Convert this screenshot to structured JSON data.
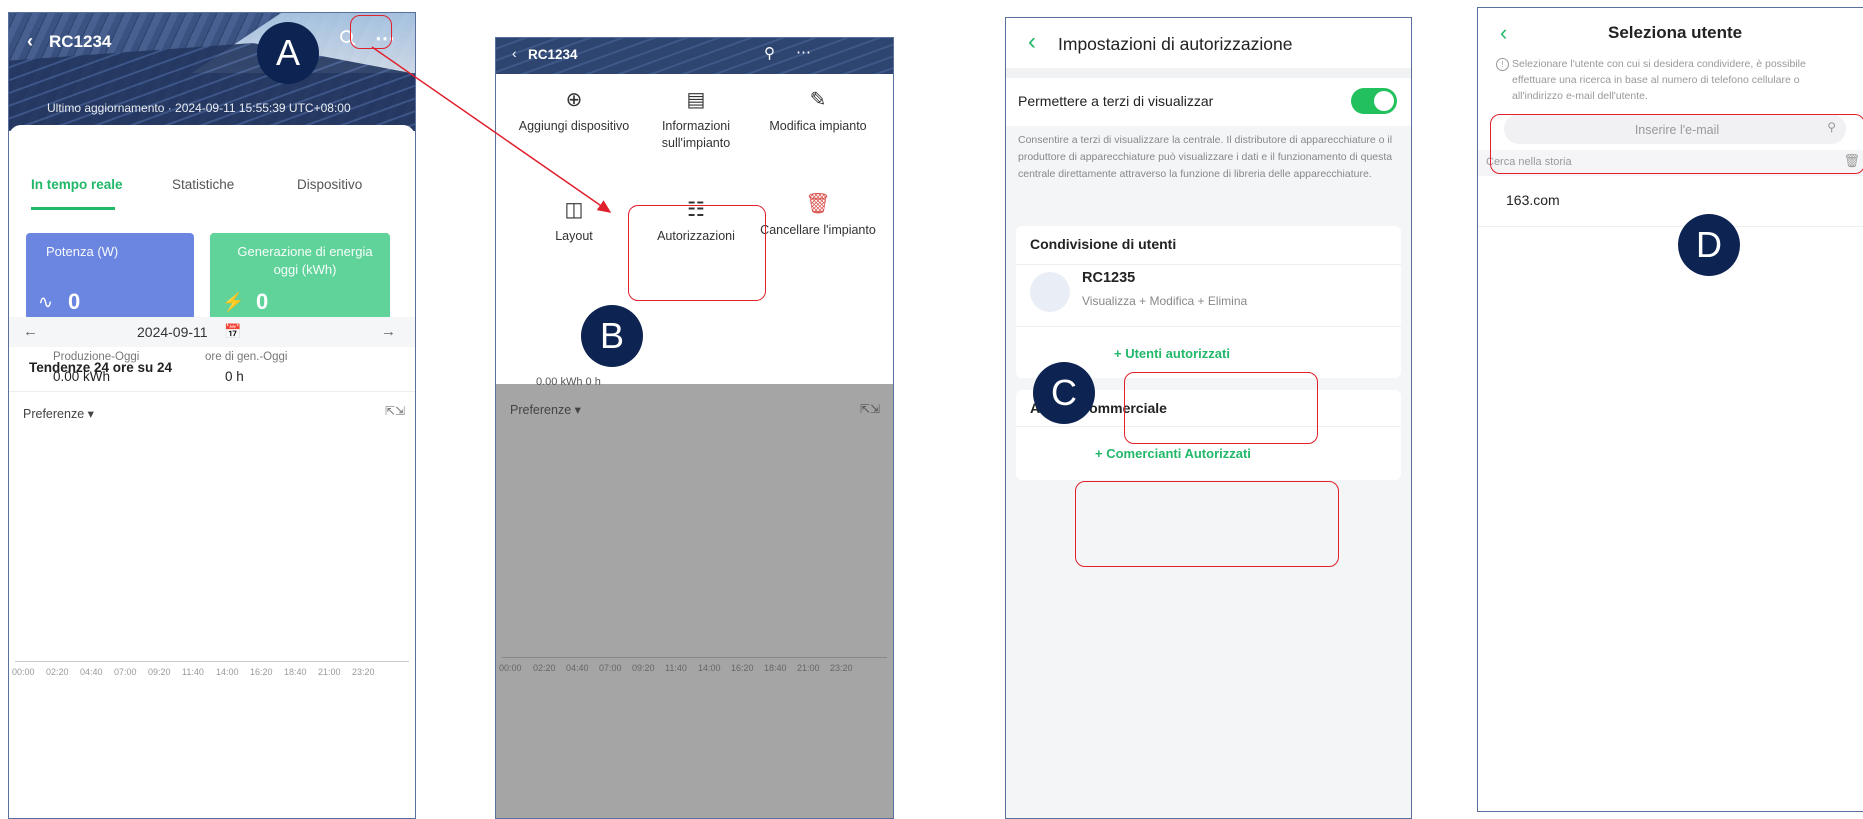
{
  "screen1": {
    "title": "RC1234",
    "last_update": "Ultimo aggiornamento · 2024-09-11 15:55:39 UTC+08:00",
    "tabs": [
      "In tempo reale",
      "Statistiche",
      "Dispositivo"
    ],
    "power_card": {
      "label": "Potenza (W)",
      "value": "0",
      "color": "#6b86e0"
    },
    "energy_card": {
      "label": "Generazione di energia oggi (kWh)",
      "value": "0",
      "color": "#5fd39a"
    },
    "trend_title": "Tendenze 24 ore su 24",
    "date": "2024-09-11",
    "kpi": {
      "production_label": "Produzione-Oggi",
      "production_value": "0.00 kWh",
      "hours_label": "ore di gen.-Oggi",
      "hours_value": "0 h"
    },
    "preference_label": "Preferenze",
    "axis_ticks": [
      "00:00",
      "02:20",
      "04:40",
      "07:00",
      "09:20",
      "11:40",
      "14:00",
      "16:20",
      "18:40",
      "21:00",
      "23:20"
    ]
  },
  "screen2": {
    "title": "RC1234",
    "menu": [
      {
        "icon": "plus-circle-icon",
        "label": "Aggiungi dispositivo"
      },
      {
        "icon": "list-icon",
        "label": "Informazioni sull'impianto"
      },
      {
        "icon": "pencil-icon",
        "label": "Modifica impianto"
      },
      {
        "icon": "layout-icon",
        "label": "Layout"
      },
      {
        "icon": "authorization-icon",
        "label": "Autorizzazioni"
      },
      {
        "icon": "trash-icon",
        "label": "Cancellare l'impianto"
      }
    ],
    "partial_values": "0.00 kWh   0 h",
    "preference_label": "Preferenze"
  },
  "screen3": {
    "title": "Impostazioni di autorizzazione",
    "toggle_label": "Permettere a terzi di visualizzar",
    "toggle_on": true,
    "description": "Consentire a terzi di visualizzare la centrale. Il distributore di apparecchiature o il produttore di apparecchiature può visualizzare i dati e il funzionamento di questa centrale direttamente attraverso la funzione di libreria delle apparecchiature.",
    "user_sharing": {
      "title": "Condivisione di utenti",
      "user_name": "RC1235",
      "permissions": "Visualizza + Modifica + Elimina",
      "add_button": "+ Utenti autorizzati"
    },
    "business": {
      "title": "Attività commerciale",
      "add_button": "+ Comercianti Autorizzati"
    }
  },
  "screen4": {
    "title": "Seleziona utente",
    "note": "Selezionare l'utente con cui si desidera condividere, è possibile effettuare una ricerca in base al numero di telefono cellulare o all'indirizzo e-mail dell'utente.",
    "search_placeholder": "Inserire l'e-mail",
    "history_label": "Cerca nella storia",
    "history_items": [
      "163.com"
    ]
  },
  "annotations": {
    "badges": [
      "A",
      "B",
      "C",
      "D"
    ],
    "highlight_color": "#e0202c",
    "badge_color": "#0d2453"
  }
}
